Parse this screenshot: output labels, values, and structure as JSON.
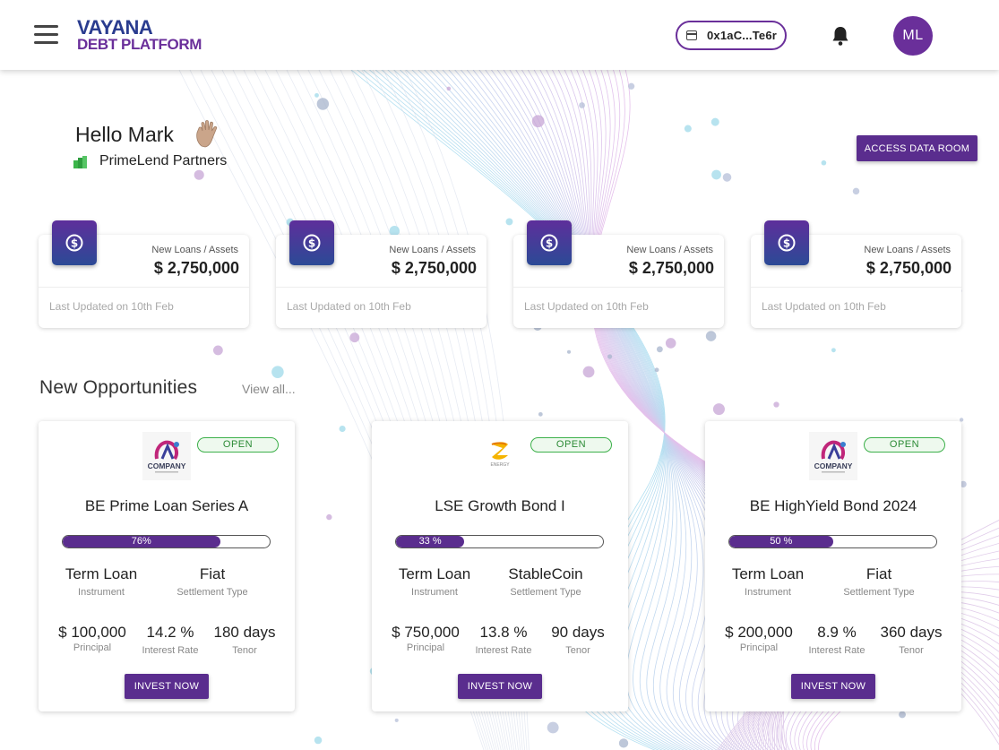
{
  "header": {
    "brand_line1": "VAYANA",
    "brand_line2": "DEBT PLATFORM",
    "wallet_address": "0x1aC...Te6r",
    "avatar_initials": "ML",
    "icons": [
      "menu-icon",
      "wallet-icon",
      "bell-icon"
    ]
  },
  "greeting": {
    "hello": "Hello Mark",
    "organization": "PrimeLend Partners",
    "data_room_label": "ACCESS DATA ROOM"
  },
  "stats": [
    {
      "label": "New Loans / Assets",
      "value": "$ 2,750,000",
      "updated": "Last Updated on 10th Feb"
    },
    {
      "label": "New Loans / Assets",
      "value": "$ 2,750,000",
      "updated": "Last Updated on 10th Feb"
    },
    {
      "label": "New Loans / Assets",
      "value": "$ 2,750,000",
      "updated": "Last Updated on 10th Feb"
    },
    {
      "label": "New Loans / Assets",
      "value": "$ 2,750,000",
      "updated": "Last Updated on 10th Feb"
    }
  ],
  "opportunities_section": {
    "title": "New Opportunities",
    "view_all": "View all..."
  },
  "opportunities": [
    {
      "logo_text": "COMPANY",
      "status": "OPEN",
      "title": "BE Prime Loan Series A",
      "progress_label": "76%",
      "progress": 76,
      "instrument": "Term Loan",
      "instrument_label": "Instrument",
      "settlement": "Fiat",
      "settlement_label": "Settlement Type",
      "principal": "$ 100,000",
      "principal_label": "Principal",
      "rate": "14.2 %",
      "rate_label": "Interest Rate",
      "tenor": "180 days",
      "tenor_label": "Tenor",
      "invest_label": "INVEST NOW"
    },
    {
      "logo_text": "ENERGY",
      "status": "OPEN",
      "title": "LSE Growth Bond I",
      "progress_label": "33 %",
      "progress": 33,
      "instrument": "Term Loan",
      "instrument_label": "Instrument",
      "settlement": "StableCoin",
      "settlement_label": "Settlement Type",
      "principal": "$ 750,000",
      "principal_label": "Principal",
      "rate": "13.8 %",
      "rate_label": "Interest Rate",
      "tenor": "90 days",
      "tenor_label": "Tenor",
      "invest_label": "INVEST NOW"
    },
    {
      "logo_text": "COMPANY",
      "status": "OPEN",
      "title": "BE HighYield Bond 2024",
      "progress_label": "50 %",
      "progress": 50,
      "instrument": "Term Loan",
      "instrument_label": "Instrument",
      "settlement": "Fiat",
      "settlement_label": "Settlement Type",
      "principal": "$ 200,000",
      "principal_label": "Principal",
      "rate": "8.9 %",
      "rate_label": "Interest Rate",
      "tenor": "360 days",
      "tenor_label": "Tenor",
      "invest_label": "INVEST NOW"
    }
  ],
  "colors": {
    "brand_blue": "#2a3c8f",
    "brand_purple": "#6a2f9a",
    "button_purple": "#5a2d8e",
    "open_green": "#3cb04a"
  }
}
